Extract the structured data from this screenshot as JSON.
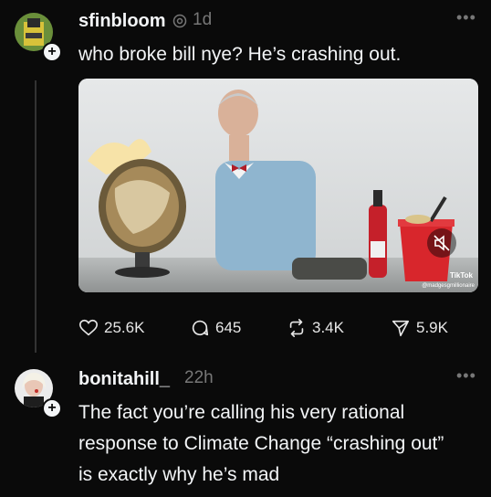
{
  "post": {
    "username": "sfinbloom",
    "time": "1d",
    "text": "who broke bill nye? He’s crashing out.",
    "video": {
      "tiktok_label": "TikTok",
      "tiktok_handle": "@madgesgmillionaire"
    },
    "actions": {
      "likes": "25.6K",
      "replies": "645",
      "reposts": "3.4K",
      "shares": "5.9K"
    }
  },
  "reply": {
    "username": "bonitahill_",
    "time": "22h",
    "lines": [
      "The fact you’re calling his very rational",
      "response to Climate Change “crashing out”",
      "is exactly why he’s mad"
    ]
  },
  "icons": {
    "more": "more-icon",
    "like": "heart-icon",
    "reply": "comment-icon",
    "repost": "repost-icon",
    "share": "send-icon",
    "follow": "plus-icon",
    "mute": "muted-speaker-icon",
    "verified": "threads-icon"
  }
}
